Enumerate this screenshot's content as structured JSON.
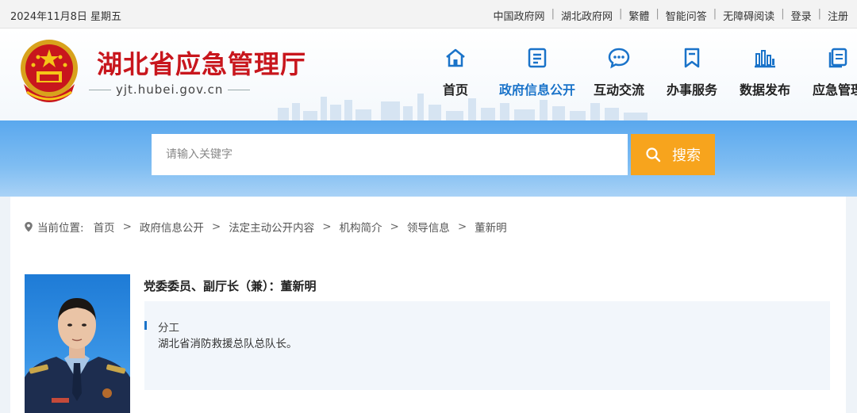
{
  "topbar": {
    "date": "2024年11月8日 星期五",
    "links": [
      "中国政府网",
      "湖北政府网",
      "繁體",
      "智能问答",
      "无障碍阅读",
      "登录",
      "注册"
    ]
  },
  "header": {
    "title": "湖北省应急管理厅",
    "domain": "yjt.hubei.gov.cn",
    "nav": [
      {
        "label": "首页",
        "icon": "home-icon"
      },
      {
        "label": "政府信息公开",
        "icon": "document-list-icon",
        "active": true
      },
      {
        "label": "互动交流",
        "icon": "chat-bubble-icon"
      },
      {
        "label": "办事服务",
        "icon": "bookmark-icon"
      },
      {
        "label": "数据发布",
        "icon": "bar-chart-icon"
      },
      {
        "label": "应急管理",
        "icon": "files-icon"
      }
    ],
    "accent_color": "#1a73c9",
    "title_color": "#c8161d"
  },
  "search": {
    "placeholder": "请输入关键字",
    "button_label": "搜索",
    "button_color": "#f7a41d"
  },
  "breadcrumb": {
    "prefix": "当前位置:",
    "items": [
      "首页",
      "政府信息公开",
      "法定主动公开内容",
      "机构简介",
      "领导信息",
      "董新明"
    ]
  },
  "profile": {
    "title": "党委委员、副厅长（兼）：董新明",
    "duty_heading": "分工",
    "duty_text": "湖北省消防救援总队总队长。"
  }
}
